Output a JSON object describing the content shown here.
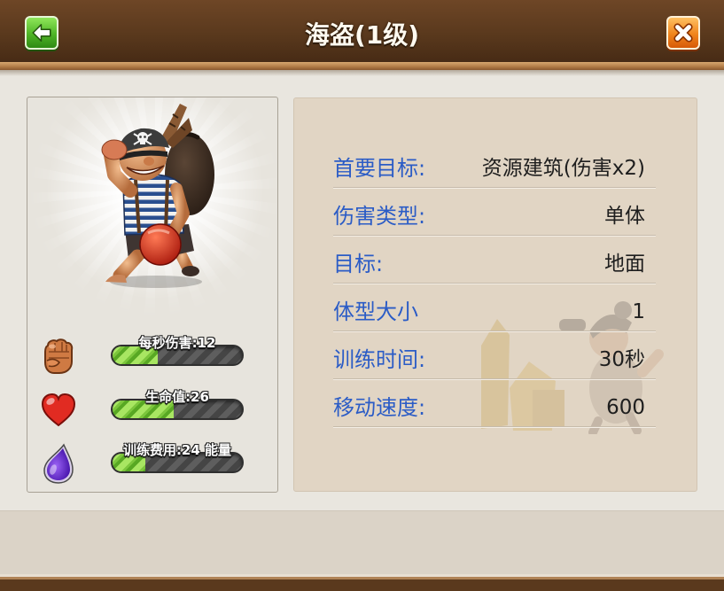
{
  "header": {
    "title": "海盗(1级)",
    "back_icon": "arrow-left-icon",
    "close_icon": "close-x-icon"
  },
  "unit": {
    "portrait": "pirate-portrait",
    "stats": [
      {
        "icon": "fist-icon",
        "label": "每秒伤害:12",
        "fill": 0.35
      },
      {
        "icon": "heart-icon",
        "label": "生命值:26",
        "fill": 0.47
      },
      {
        "icon": "energy-drop-icon",
        "label": "训练费用:24 能量",
        "fill": 0.25
      }
    ]
  },
  "details": {
    "rows": [
      {
        "label": "首要目标:",
        "value": "资源建筑(伤害x2)"
      },
      {
        "label": "伤害类型:",
        "value": "单体"
      },
      {
        "label": "目标:",
        "value": "地面"
      },
      {
        "label": "体型大小",
        "value": "1"
      },
      {
        "label": "训练时间:",
        "value": "30秒"
      },
      {
        "label": "移动速度:",
        "value": "600"
      }
    ]
  },
  "colors": {
    "header_brown": "#5a391d",
    "label_blue": "#2b5cc6",
    "value_text": "#1e1e1e",
    "back_button_green": "#4fb526",
    "close_button_orange": "#f0841c",
    "bar_fill_green": "#7cc63c"
  }
}
